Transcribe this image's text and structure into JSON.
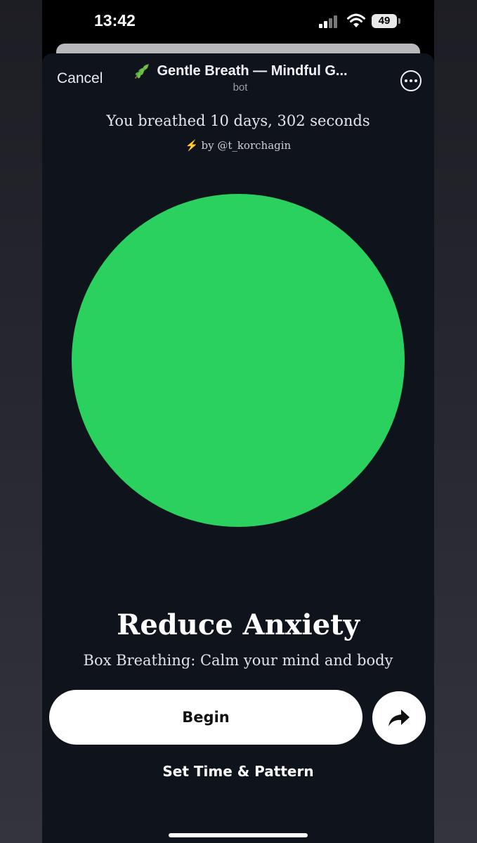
{
  "status_bar": {
    "time": "13:42",
    "battery": "49"
  },
  "header": {
    "cancel_label": "Cancel",
    "title": "Gentle Breath — Mindful G...",
    "subtitle": "bot"
  },
  "main": {
    "stats_text": "You breathed 10 days, 302 seconds",
    "credit_text": "by @t_korchagin",
    "circle_color": "#2ad15e",
    "heading": "Reduce Anxiety",
    "description": "Box Breathing: Calm your mind and body",
    "begin_label": "Begin",
    "pattern_label": "Set Time & Pattern"
  },
  "colors": {
    "background": "#0f131c",
    "accent_green": "#2ad15e",
    "button_bg": "#ffffff"
  }
}
